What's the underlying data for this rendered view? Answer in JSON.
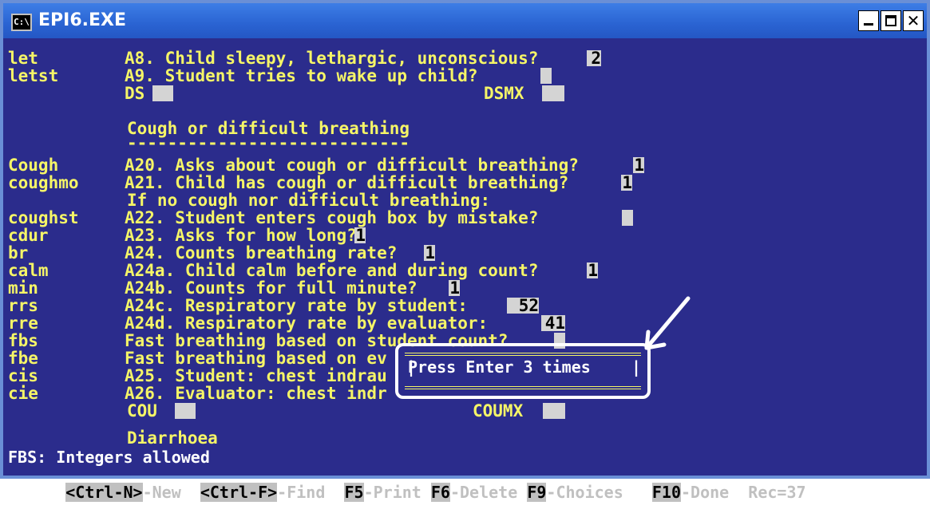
{
  "window": {
    "title": "EPI6.EXE",
    "icon": "C:\\"
  },
  "lines": [
    {
      "var": "let",
      "label": "A8. Child sleepy, lethargic, unconscious?",
      "value": "2"
    },
    {
      "var": "letst",
      "label": "A9. Student tries to wake up child?",
      "value": ""
    },
    {
      "var": "",
      "label": "DS",
      "value": ""
    },
    {
      "var": "",
      "label": "DSMX",
      "value": ""
    },
    {
      "var": "",
      "label": "Cough or difficult breathing",
      "value": ""
    },
    {
      "var": "",
      "label": "----------------------------",
      "value": ""
    },
    {
      "var": "Cough",
      "label": "A20. Asks about cough or difficult breathing?",
      "value": "1"
    },
    {
      "var": "coughmo",
      "label": "A21. Child has cough or difficult breathing?",
      "value": "1"
    },
    {
      "var": "",
      "label": "If no cough nor difficult breathing:",
      "value": ""
    },
    {
      "var": "coughst",
      "label": "A22. Student enters cough box by mistake?",
      "value": ""
    },
    {
      "var": "cdur",
      "label": "A23. Asks for how long?",
      "value": "1"
    },
    {
      "var": "br",
      "label": "A24. Counts breathing rate?",
      "value": "1"
    },
    {
      "var": "calm",
      "label": "A24a. Child calm before and during count?",
      "value": "1"
    },
    {
      "var": "min",
      "label": "A24b. Counts for full minute?",
      "value": "1"
    },
    {
      "var": "rrs",
      "label": "A24c. Respiratory rate by student:",
      "value": "52"
    },
    {
      "var": "rre",
      "label": "A24d. Respiratory rate by evaluator:",
      "value": "41"
    },
    {
      "var": "fbs",
      "label": "Fast breathing based on student count?",
      "value": ""
    },
    {
      "var": "fbe",
      "label": "Fast breathing based on ev",
      "value": ""
    },
    {
      "var": "cis",
      "label": "A25. Student: chest indrau",
      "value": ""
    },
    {
      "var": "cie",
      "label": "A26. Evaluator: chest indr",
      "value": ""
    },
    {
      "var": "",
      "label": "COU",
      "value": ""
    },
    {
      "var": "",
      "label": "COUMX",
      "value": ""
    },
    {
      "var": "",
      "label": "Diarrhoea",
      "value": ""
    }
  ],
  "status": "FBS: Integers allowed",
  "popup": {
    "message": "Press Enter 3 times"
  },
  "keys": {
    "k1": "<Ctrl-N>",
    "l1": "-New",
    "k2": "<Ctrl-F>",
    "l2": "-Find",
    "k3": "F5",
    "l3": "-Print",
    "k4": "F6",
    "l4": "-Delete",
    "k5": "F9",
    "l5": "-Choices",
    "k6": "F10",
    "l6": "-Done",
    "rec_label": "Rec=",
    "rec_value": "37"
  }
}
